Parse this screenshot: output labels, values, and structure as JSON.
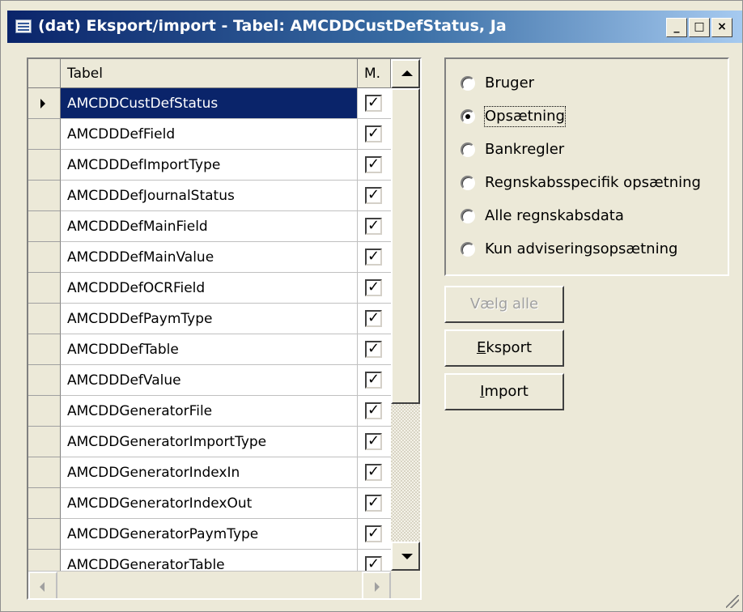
{
  "window": {
    "title": "(dat) Eksport/import - Tabel: AMCDDCustDefStatus, Ja",
    "icons": {
      "app": "form-icon",
      "minimize": "minimize-icon",
      "maximize": "maximize-icon",
      "close": "close-icon"
    },
    "controls": {
      "minimize": "_",
      "maximize": "□",
      "close": "×"
    }
  },
  "grid": {
    "columns": [
      "Tabel",
      "M."
    ],
    "rows": [
      {
        "name": "AMCDDCustDefStatus",
        "checked": true,
        "current": true
      },
      {
        "name": "AMCDDDefField",
        "checked": true
      },
      {
        "name": "AMCDDDefImportType",
        "checked": true
      },
      {
        "name": "AMCDDDefJournalStatus",
        "checked": true
      },
      {
        "name": "AMCDDDefMainField",
        "checked": true
      },
      {
        "name": "AMCDDDefMainValue",
        "checked": true
      },
      {
        "name": "AMCDDDefOCRField",
        "checked": true
      },
      {
        "name": "AMCDDDefPaymType",
        "checked": true
      },
      {
        "name": "AMCDDDefTable",
        "checked": true
      },
      {
        "name": "AMCDDDefValue",
        "checked": true
      },
      {
        "name": "AMCDDGeneratorFile",
        "checked": true
      },
      {
        "name": "AMCDDGeneratorImportType",
        "checked": true
      },
      {
        "name": "AMCDDGeneratorIndexIn",
        "checked": true
      },
      {
        "name": "AMCDDGeneratorIndexOut",
        "checked": true
      },
      {
        "name": "AMCDDGeneratorPaymType",
        "checked": true
      },
      {
        "name": "AMCDDGeneratorTable",
        "checked": true
      }
    ],
    "check_glyph": "✓"
  },
  "options": {
    "selected_index": 1,
    "items": [
      "Bruger",
      "Opsætning",
      "Bankregler",
      "Regnskabsspecifik opsætning",
      "Alle regnskabsdata",
      "Kun adviseringsopsætning"
    ]
  },
  "buttons": {
    "select_all": {
      "label": "Vælg alle",
      "enabled": false
    },
    "export": {
      "accel": "E",
      "rest": "ksport"
    },
    "import": {
      "accel": "I",
      "rest": "mport"
    }
  }
}
